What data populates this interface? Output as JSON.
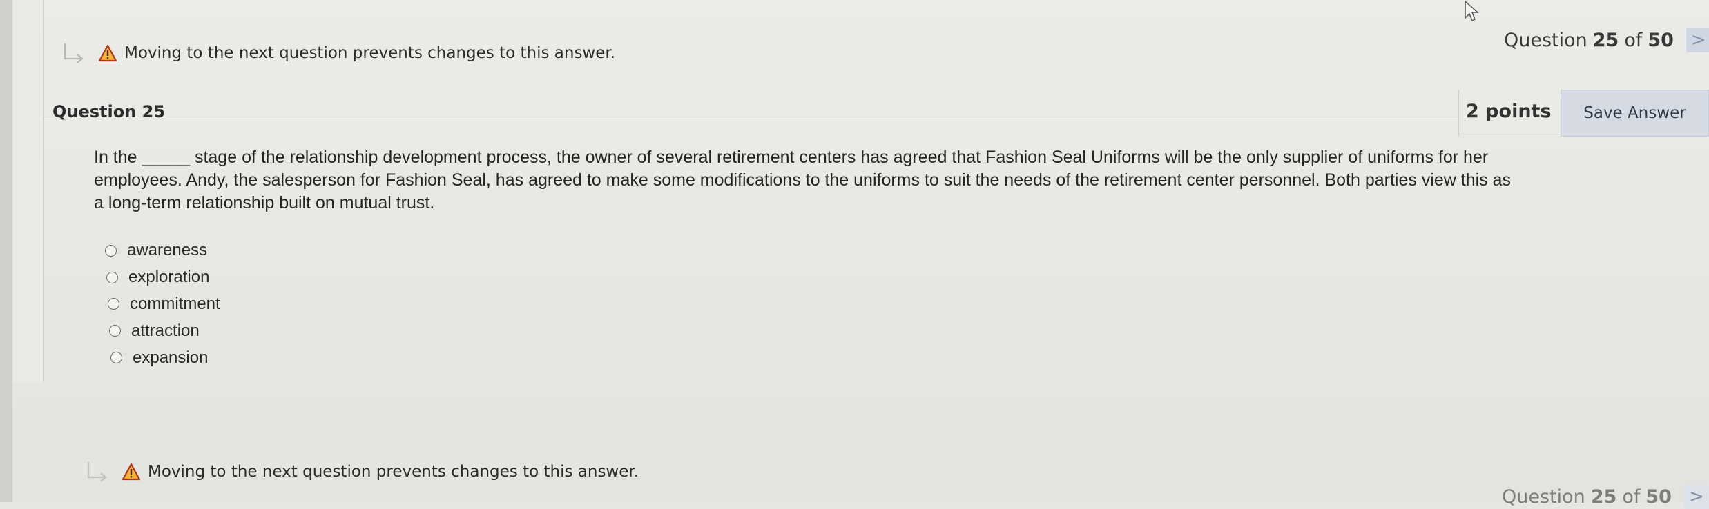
{
  "warning": {
    "text": "Moving to the next question prevents changes to this answer."
  },
  "navigation": {
    "prefix": "Question",
    "current": "25",
    "separator": "of",
    "total": "50",
    "next_icon": "chevron-right-icon",
    "next_glyph": ">"
  },
  "question": {
    "title": "Question 25",
    "points": "2 points",
    "save_label": "Save Answer",
    "text_line1": "In the _____ stage of the relationship development process, the owner of several retirement centers has agreed that Fashion Seal Uniforms will be the only supplier of uniforms for her",
    "text_line2": "employees. Andy, the salesperson for Fashion Seal, has agreed to make some modifications to the uniforms to suit the needs of the retirement center personnel. Both parties view this as",
    "text_line3": "a long-term relationship built on mutual trust.",
    "options": [
      {
        "label": "awareness"
      },
      {
        "label": "exploration"
      },
      {
        "label": "commitment"
      },
      {
        "label": "attraction"
      },
      {
        "label": "expansion"
      }
    ]
  },
  "colors": {
    "warning_icon": "#e8a317",
    "next_button": "#cfd7e3",
    "save_button": "#d6dbe3"
  }
}
